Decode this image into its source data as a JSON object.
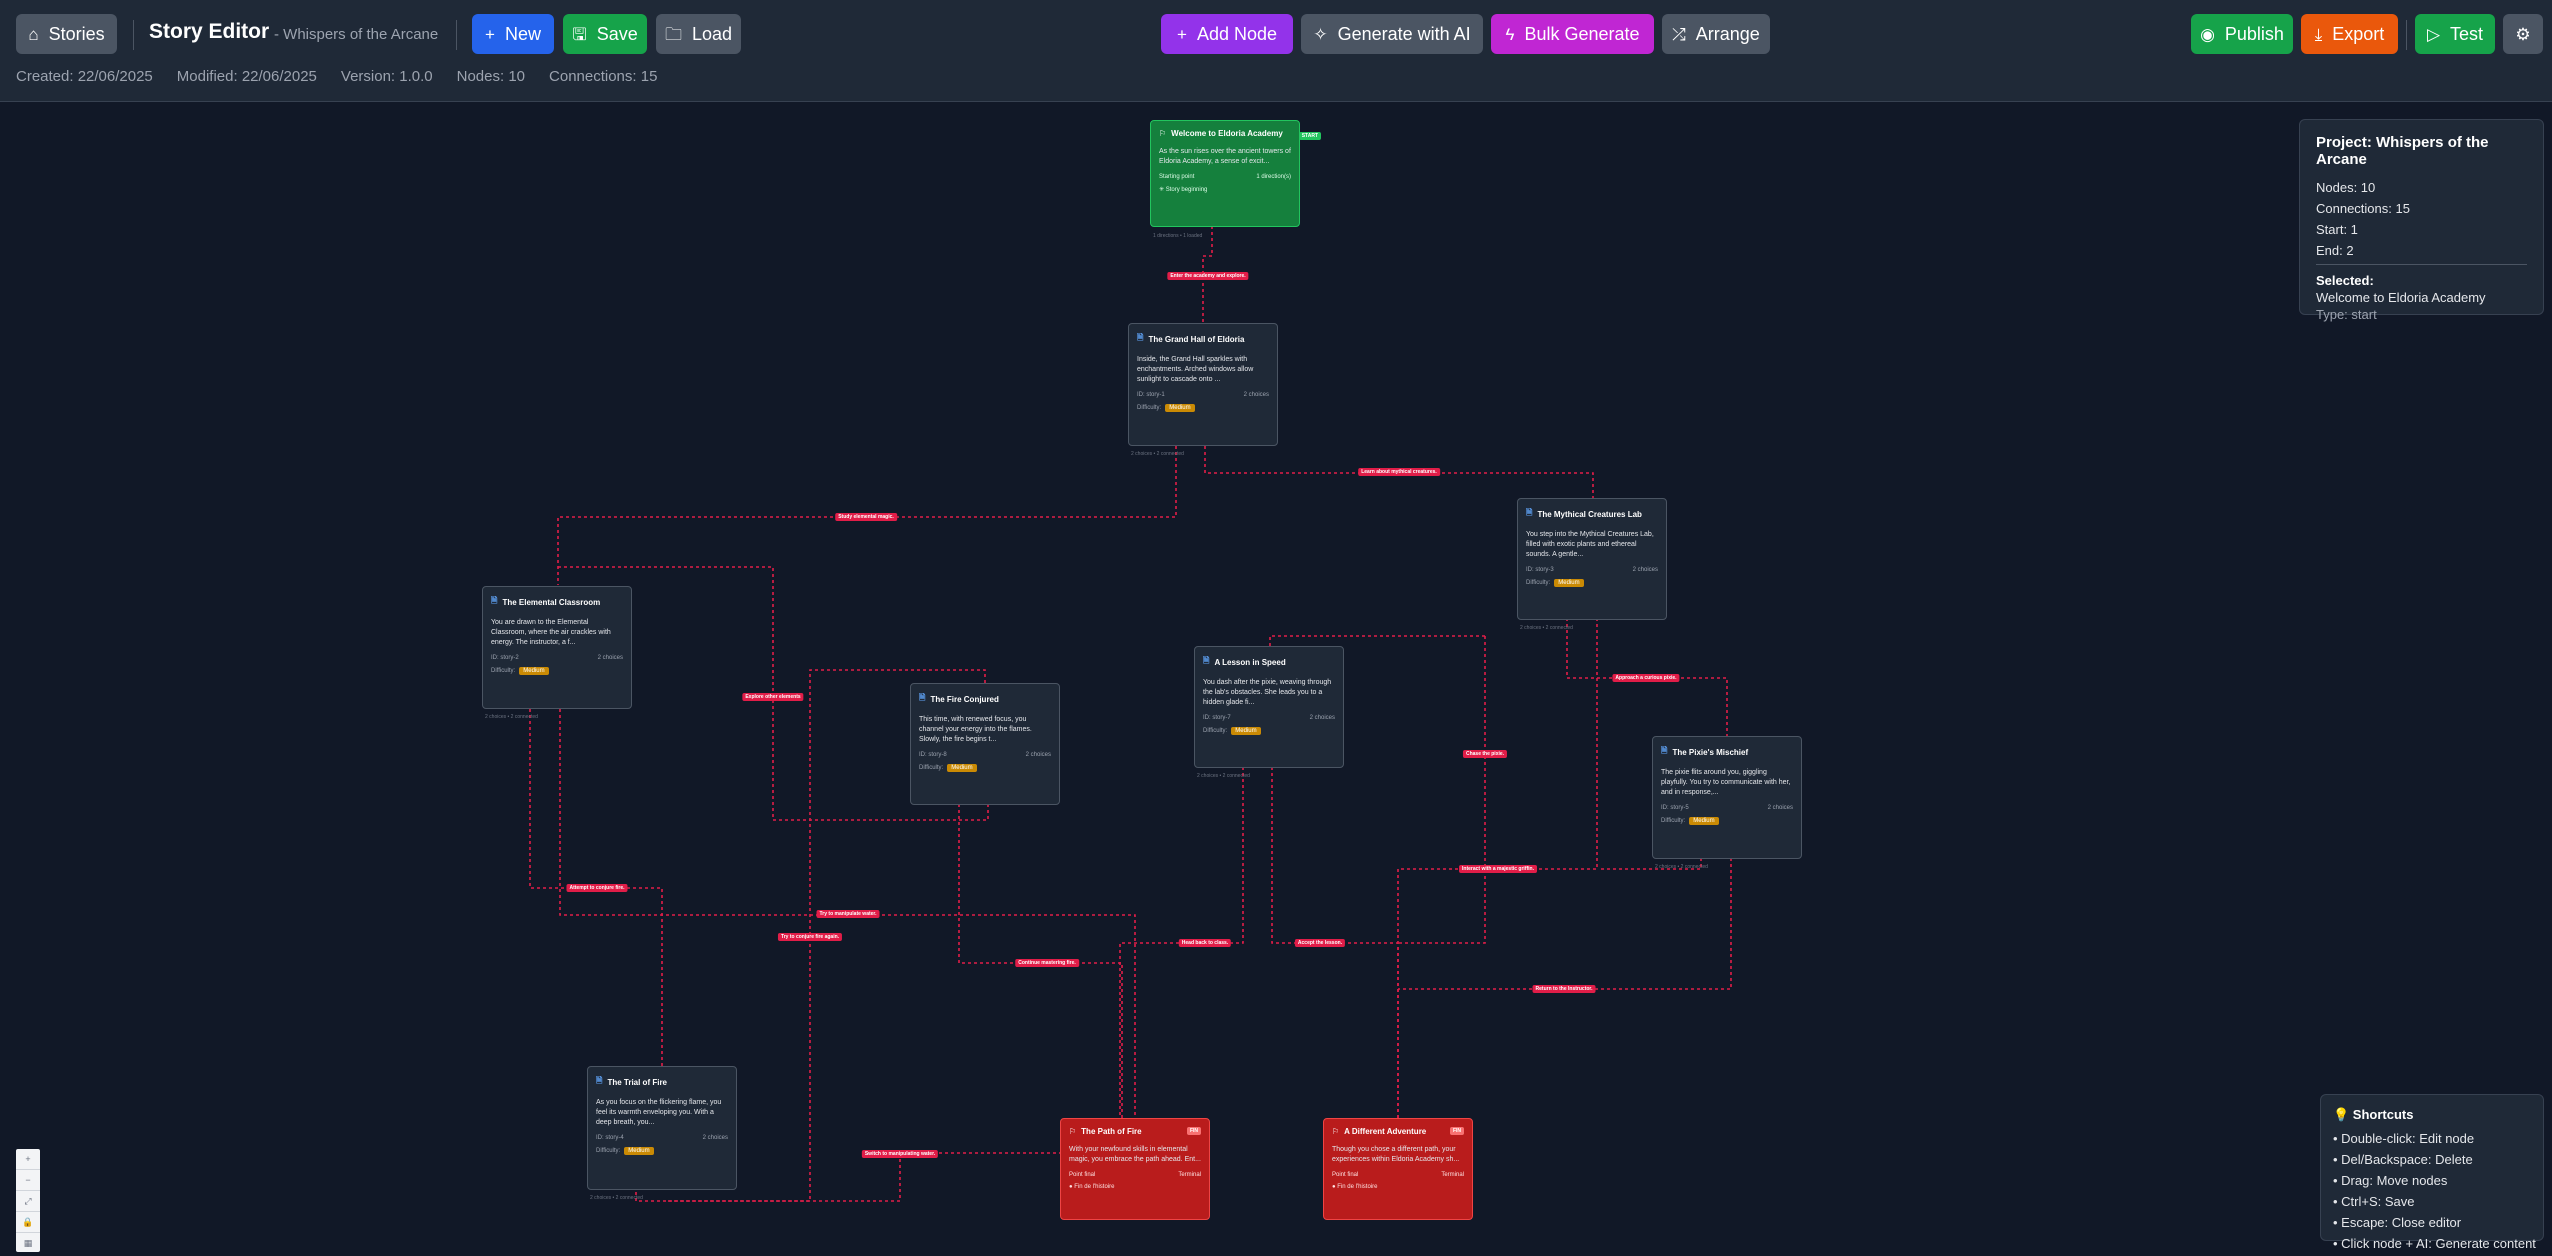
{
  "header": {
    "stories_label": "Stories",
    "title": "Story Editor",
    "subtitle": "- Whispers of the Arcane",
    "new_label": "New",
    "save_label": "Save",
    "load_label": "Load",
    "add_node_label": "Add Node",
    "generate_ai_label": "Generate with AI",
    "bulk_generate_label": "Bulk Generate",
    "arrange_label": "Arrange",
    "publish_label": "Publish",
    "export_label": "Export",
    "test_label": "Test",
    "settings_icon": "gear-icon"
  },
  "meta": {
    "created": "Created: 22/06/2025",
    "modified": "Modified: 22/06/2025",
    "version": "Version: 1.0.0",
    "nodes": "Nodes: 10",
    "connections": "Connections: 15"
  },
  "nodes": {
    "welcome": {
      "title": "Welcome to Eldoria Academy",
      "tag": "START",
      "text": "As the sun rises over the ancient towers of Eldoria Academy, a sense of excit...",
      "f_left": "Starting point",
      "f_right": "1 direction(s)",
      "d": "✳ Story beginning",
      "sub": "1 directions • 1 loaded"
    },
    "grand_hall": {
      "title": "The Grand Hall of Eldoria",
      "text": "Inside, the Grand Hall sparkles with enchantments. Arched windows allow sunlight to cascade onto ...",
      "f_left": "ID: story-1",
      "f_right": "2 choices",
      "d_label": "Difficulty:",
      "d_badge": "Medium",
      "sub": "2 choices • 2 connected"
    },
    "mythical_lab": {
      "title": "The Mythical Creatures Lab",
      "text": "You step into the Mythical Creatures Lab, filled with exotic plants and ethereal sounds. A gentle...",
      "f_left": "ID: story-3",
      "f_right": "2 choices",
      "d_label": "Difficulty:",
      "d_badge": "Medium",
      "sub": "2 choices • 2 connected"
    },
    "elemental": {
      "title": "The Elemental Classroom",
      "text": "You are drawn to the Elemental Classroom, where the air crackles with energy. The instructor, a f...",
      "f_left": "ID: story-2",
      "f_right": "2 choices",
      "d_label": "Difficulty:",
      "d_badge": "Medium",
      "sub": "2 choices • 2 connected"
    },
    "fire_conjured": {
      "title": "The Fire Conjured",
      "text": "This time, with renewed focus, you channel your energy into the flames. Slowly, the fire begins t...",
      "f_left": "ID: story-8",
      "f_right": "2 choices",
      "d_label": "Difficulty:",
      "d_badge": "Medium",
      "sub": "2 choices • 2 connected"
    },
    "lesson_speed": {
      "title": "A Lesson in Speed",
      "text": "You dash after the pixie, weaving through the lab's obstacles. She leads you to a hidden glade fi...",
      "f_left": "ID: story-7",
      "f_right": "2 choices",
      "d_label": "Difficulty:",
      "d_badge": "Medium",
      "sub": "2 choices • 2 connected"
    },
    "pixie": {
      "title": "The Pixie's Mischief",
      "text": "The pixie flits around you, giggling playfully. You try to communicate with her, and in response,...",
      "f_left": "ID: story-5",
      "f_right": "2 choices",
      "d_label": "Difficulty:",
      "d_badge": "Medium",
      "sub": "2 choices • 2 connected"
    },
    "trial_fire": {
      "title": "The Trial of Fire",
      "text": "As you focus on the flickering flame, you feel its warmth enveloping you. With a deep breath, you...",
      "f_left": "ID: story-4",
      "f_right": "2 choices",
      "d_label": "Difficulty:",
      "d_badge": "Medium",
      "sub": "2 choices • 2 connected"
    },
    "path_fire": {
      "title": "The Path of Fire",
      "tag": "FIN",
      "text": "With your newfound skills in elemental magic, you embrace the path ahead. Ent...",
      "f_left": "Point final",
      "f_right": "Terminal",
      "d": "● Fin de l'histoire"
    },
    "different": {
      "title": "A Different Adventure",
      "tag": "FIN",
      "text": "Though you chose a different path, your experiences within Eldoria Academy sh...",
      "f_left": "Point final",
      "f_right": "Terminal",
      "d": "● Fin de l'histoire"
    }
  },
  "connection_labels": {
    "l1": "Enter the academy and explore.",
    "l2": "Learn about mythical creatures.",
    "l3": "Study elemental magic.",
    "l4": "Explore other elements",
    "l5": "Approach a curious pixie.",
    "l6": "Chase the pixie.",
    "l7": "Attempt to conjure fire.",
    "l8": "Try to manipulate water.",
    "l9": "Try to conjure fire again.",
    "l10": "Interact with a majestic griffin.",
    "l11": "Head back to class.",
    "l12": "Accept the lesson.",
    "l13": "Continue mastering fire.",
    "l14": "Return to the Instructor.",
    "l15": "Switch to manipulating water."
  },
  "project": {
    "title": "Project: Whispers of the Arcane",
    "nodes": "Nodes: 10",
    "connections": "Connections: 15",
    "start": "Start: 1",
    "end": "End: 2",
    "selected_label": "Selected:",
    "selected_name": "Welcome to Eldoria Academy",
    "selected_type": "Type: start"
  },
  "shortcuts": {
    "title": "💡 Shortcuts",
    "items": [
      "• Double-click: Edit node",
      "• Del/Backspace: Delete",
      "• Drag: Move nodes",
      "• Ctrl+S: Save",
      "• Escape: Close editor",
      "• Click node + AI: Generate content"
    ]
  },
  "colors": {
    "accent_start": "#15803d",
    "accent_end": "#b91c1c",
    "connection": "#e11d48",
    "badge_medium": "#ca8a04"
  }
}
